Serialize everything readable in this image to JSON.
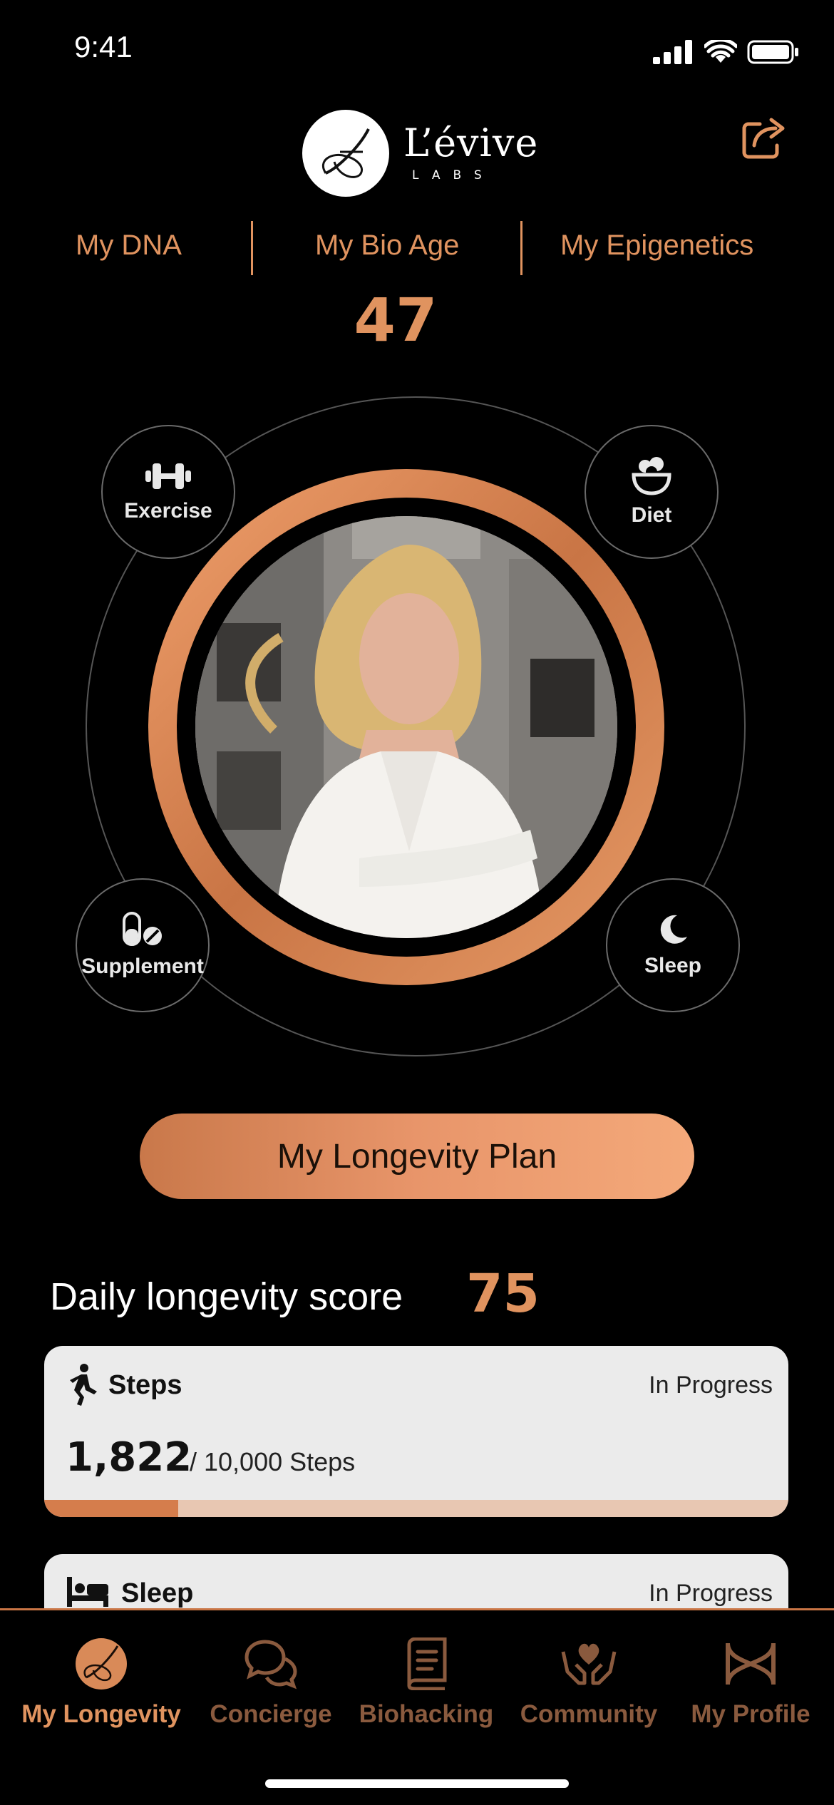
{
  "status_bar": {
    "time": "9:41"
  },
  "brand": {
    "name": "L’évive",
    "sub": "LABS"
  },
  "tabs": [
    {
      "label": "My DNA"
    },
    {
      "label": "My Bio Age"
    },
    {
      "label": "My Epigenetics"
    }
  ],
  "bio_age": {
    "value": "47"
  },
  "pillars": {
    "exercise": "Exercise",
    "diet": "Diet",
    "supplement": "Supplement",
    "sleep": "Sleep"
  },
  "plan_button": {
    "label": "My Longevity Plan"
  },
  "score": {
    "label": "Daily longevity score",
    "value": "75"
  },
  "cards": {
    "steps": {
      "title": "Steps",
      "status": "In Progress",
      "value": "1,822",
      "goal": "/ 10,000 Steps",
      "progress": 0.18
    },
    "sleep": {
      "title": "Sleep",
      "status": "In Progress"
    }
  },
  "nav": {
    "items": [
      {
        "label": "My Longevity",
        "active": true
      },
      {
        "label": "Concierge"
      },
      {
        "label": "Biohacking"
      },
      {
        "label": "Community"
      },
      {
        "label": "My Profile"
      }
    ]
  },
  "colors": {
    "accent": "#e0935f",
    "nav_inactive": "#8a5a3e",
    "card_bg": "#ebebeb"
  }
}
